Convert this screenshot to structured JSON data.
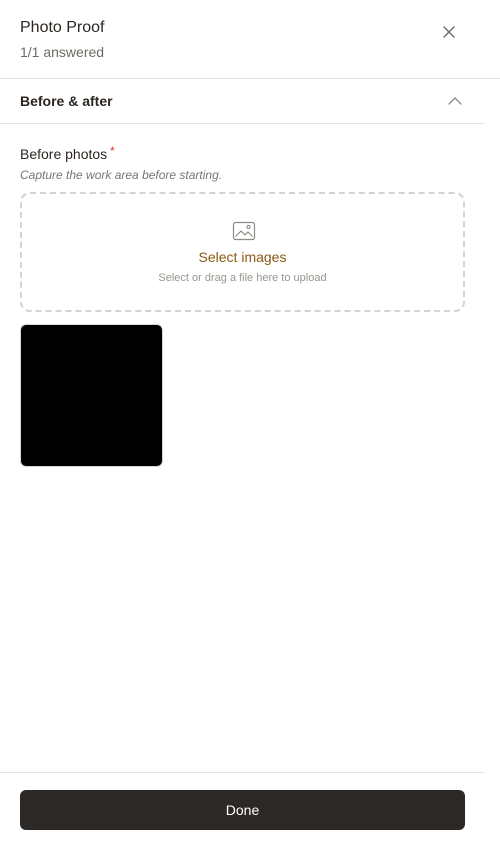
{
  "header": {
    "title": "Photo Proof",
    "subtitle": "1/1 answered",
    "close_icon": "close-icon"
  },
  "section": {
    "label": "Before & after",
    "chevron_icon": "chevron-up-icon"
  },
  "field": {
    "label": "Before photos",
    "required_mark": "*",
    "help": "Capture the work area before starting."
  },
  "dropzone": {
    "icon": "image-icon",
    "select_label": "Select images",
    "hint": "Select or drag a file here to upload"
  },
  "uploads": [
    {
      "thumbnail_color": "#000000"
    }
  ],
  "footer": {
    "done_label": "Done"
  },
  "colors": {
    "accent_text": "#8a5a12",
    "required": "#e0322e",
    "primary_button": "#2b2826"
  }
}
